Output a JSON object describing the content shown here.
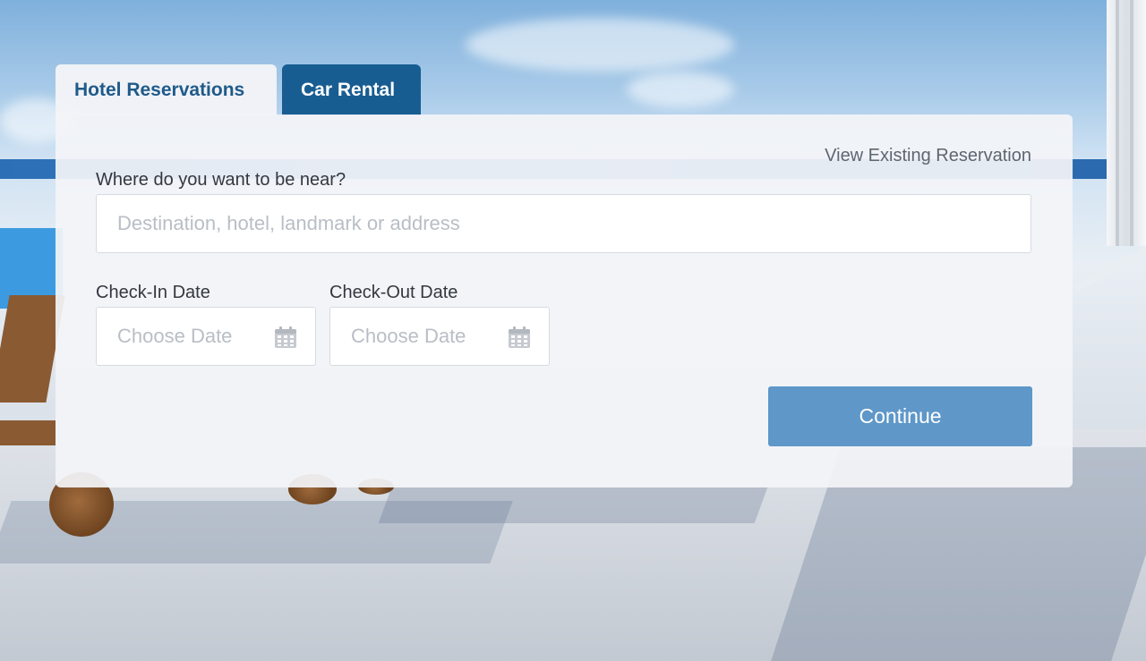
{
  "tabs": {
    "hotel_label": "Hotel Reservations",
    "car_label": "Car Rental",
    "active": "Hotel Reservations"
  },
  "form": {
    "view_existing_link": "View Existing Reservation",
    "destination_label": "Where do you want to be near?",
    "destination_placeholder": "Destination, hotel, landmark or address",
    "destination_value": "",
    "checkin_label": "Check-In Date",
    "checkin_placeholder": "Choose Date",
    "checkout_label": "Check-Out Date",
    "checkout_placeholder": "Choose Date",
    "continue_label": "Continue"
  },
  "icons": {
    "checkin": "calendar-icon",
    "checkout": "calendar-icon"
  },
  "colors": {
    "active_tab_text": "#1f5a8a",
    "inactive_tab_bg": "#185d92",
    "continue_button": "#5e97c8",
    "placeholder_text": "#b9bec5"
  }
}
